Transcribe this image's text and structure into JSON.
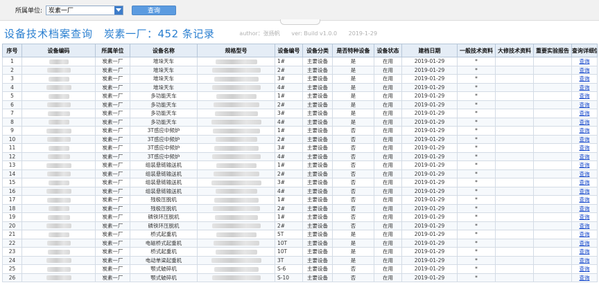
{
  "filter": {
    "unit_label": "所属单位:",
    "unit_value": "炭素一厂",
    "query_label": "查询"
  },
  "header": {
    "title": "设备技术档案查询",
    "subtitle": "炭素一厂：452 条记录",
    "author": "author：张扬帆",
    "version": "ver: Build v1.0.0",
    "date": "2019-1-29"
  },
  "table": {
    "columns": [
      "序号",
      "设备编码",
      "所属单位",
      "设备名称",
      "规格型号",
      "设备编号",
      "设备分类",
      "是否特种设备",
      "设备状态",
      "建档日期",
      "一般技术资料",
      "大修技术资料",
      "重要实验报告",
      "查询详细信息"
    ],
    "rows": [
      [
        "1",
        "炭素一厂",
        "堆垛天车",
        "1#",
        "主要设备",
        "是",
        "在用",
        "2019-01-29",
        "*",
        "查询"
      ],
      [
        "2",
        "炭素一厂",
        "堆垛天车",
        "2#",
        "主要设备",
        "是",
        "在用",
        "2019-01-29",
        "*",
        "查询"
      ],
      [
        "3",
        "炭素一厂",
        "堆垛天车",
        "3#",
        "主要设备",
        "是",
        "在用",
        "2019-01-29",
        "*",
        "查询"
      ],
      [
        "4",
        "炭素一厂",
        "堆垛天车",
        "4#",
        "主要设备",
        "是",
        "在用",
        "2019-01-29",
        "*",
        "查询"
      ],
      [
        "5",
        "炭素一厂",
        "多功能天车",
        "1#",
        "主要设备",
        "是",
        "在用",
        "2019-01-29",
        "*",
        "查询"
      ],
      [
        "6",
        "炭素一厂",
        "多功能天车",
        "2#",
        "主要设备",
        "是",
        "在用",
        "2019-01-29",
        "*",
        "查询"
      ],
      [
        "7",
        "炭素一厂",
        "多功能天车",
        "3#",
        "主要设备",
        "是",
        "在用",
        "2019-01-29",
        "*",
        "查询"
      ],
      [
        "8",
        "炭素一厂",
        "多功能天车",
        "4#",
        "主要设备",
        "是",
        "在用",
        "2019-01-29",
        "*",
        "查询"
      ],
      [
        "9",
        "炭素一厂",
        "3T感应中频炉",
        "1#",
        "主要设备",
        "否",
        "在用",
        "2019-01-29",
        "*",
        "查询"
      ],
      [
        "10",
        "炭素一厂",
        "3T感应中频炉",
        "2#",
        "主要设备",
        "否",
        "在用",
        "2019-01-29",
        "*",
        "查询"
      ],
      [
        "11",
        "炭素一厂",
        "3T感应中频炉",
        "3#",
        "主要设备",
        "否",
        "在用",
        "2019-01-29",
        "*",
        "查询"
      ],
      [
        "12",
        "炭素一厂",
        "3T感应中频炉",
        "4#",
        "主要设备",
        "否",
        "在用",
        "2019-01-29",
        "*",
        "查询"
      ],
      [
        "13",
        "炭素一厂",
        "组装悬链输送机",
        "1#",
        "主要设备",
        "否",
        "在用",
        "2019-01-29",
        "*",
        "查询"
      ],
      [
        "14",
        "炭素一厂",
        "组装悬链输送机",
        "2#",
        "主要设备",
        "否",
        "在用",
        "2019-01-29",
        "*",
        "查询"
      ],
      [
        "15",
        "炭素一厂",
        "组装悬链输送机",
        "3#",
        "主要设备",
        "否",
        "在用",
        "2019-01-29",
        "*",
        "查询"
      ],
      [
        "16",
        "炭素一厂",
        "组装悬链输送机",
        "4#",
        "主要设备",
        "否",
        "在用",
        "2019-01-29",
        "*",
        "查询"
      ],
      [
        "17",
        "炭素一厂",
        "残极压脱机",
        "1#",
        "主要设备",
        "否",
        "在用",
        "2019-01-29",
        "*",
        "查询"
      ],
      [
        "18",
        "炭素一厂",
        "残极压脱机",
        "2#",
        "主要设备",
        "否",
        "在用",
        "2019-01-29",
        "*",
        "查询"
      ],
      [
        "19",
        "炭素一厂",
        "磷铁环压脱机",
        "1#",
        "主要设备",
        "否",
        "在用",
        "2019-01-29",
        "*",
        "查询"
      ],
      [
        "20",
        "炭素一厂",
        "磷铁环压脱机",
        "2#",
        "主要设备",
        "否",
        "在用",
        "2019-01-29",
        "*",
        "查询"
      ],
      [
        "21",
        "炭素一厂",
        "桥式起重机",
        "5T",
        "主要设备",
        "是",
        "在用",
        "2019-01-29",
        "*",
        "查询"
      ],
      [
        "22",
        "炭素一厂",
        "电磁桥式起重机",
        "10T",
        "主要设备",
        "是",
        "在用",
        "2019-01-29",
        "*",
        "查询"
      ],
      [
        "23",
        "炭素一厂",
        "桥式起重机",
        "10T",
        "主要设备",
        "是",
        "在用",
        "2019-01-29",
        "*",
        "查询"
      ],
      [
        "24",
        "炭素一厂",
        "电动单梁起重机",
        "3T",
        "主要设备",
        "是",
        "在用",
        "2019-01-29",
        "*",
        "查询"
      ],
      [
        "25",
        "炭素一厂",
        "颚式破碎机",
        "S-6",
        "主要设备",
        "否",
        "在用",
        "2019-01-29",
        "*",
        "查询"
      ],
      [
        "26",
        "炭素一厂",
        "颚式破碎机",
        "S-10",
        "主要设备",
        "否",
        "在用",
        "2019-01-29",
        "*",
        "查询"
      ]
    ]
  },
  "colors": {
    "accent": "#2a7fd0",
    "link": "#0b3fc8",
    "header_bg": "#e5edf6"
  }
}
